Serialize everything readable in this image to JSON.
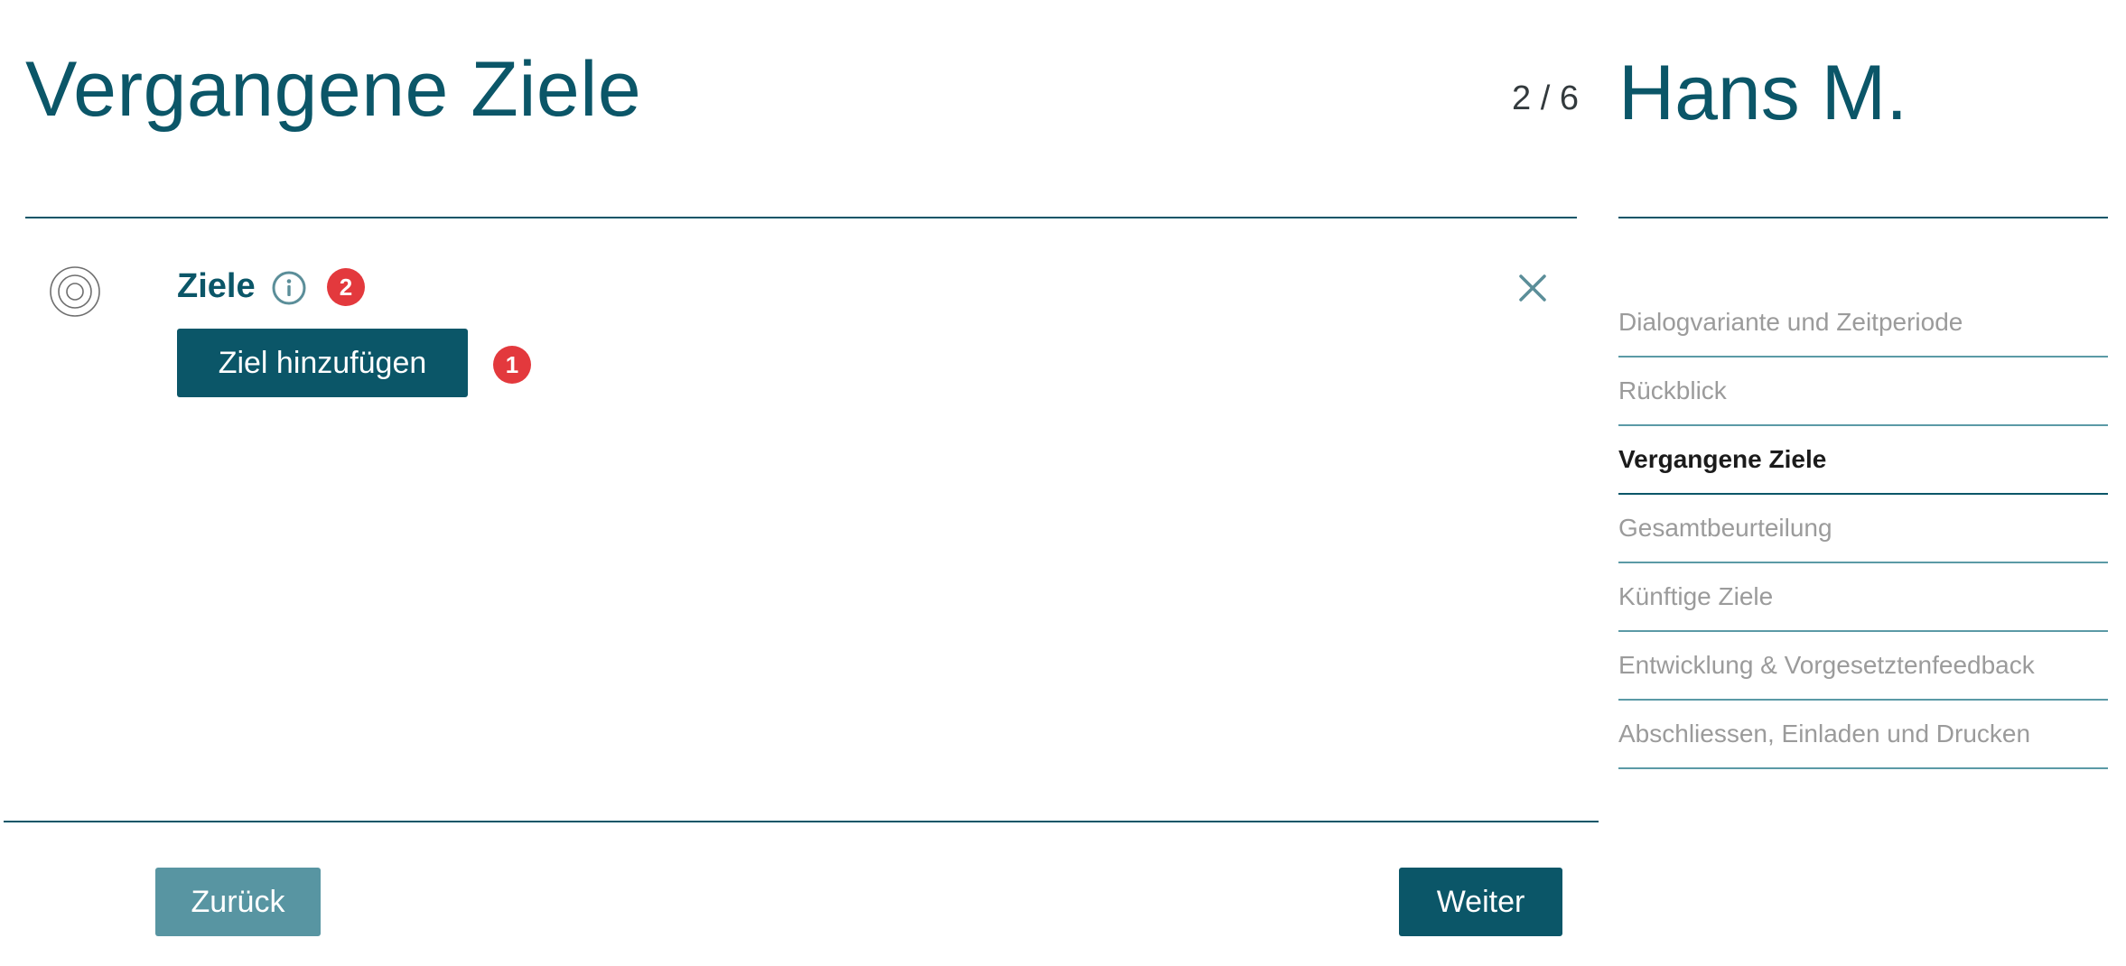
{
  "header": {
    "title": "Vergangene Ziele",
    "step": "2 / 6",
    "person_name": "Hans M."
  },
  "goals": {
    "section_title": "Ziele",
    "info_badge": "2",
    "add_button_label": "Ziel hinzufügen",
    "add_badge": "1",
    "icons": [
      "target-icon",
      "info-icon",
      "close-icon"
    ]
  },
  "navigation": {
    "items": [
      {
        "label": "Dialogvariante und Zeitperiode",
        "active": false
      },
      {
        "label": "Rückblick",
        "active": false
      },
      {
        "label": "Vergangene Ziele",
        "active": true
      },
      {
        "label": "Gesamtbeurteilung",
        "active": false
      },
      {
        "label": "Künftige Ziele",
        "active": false
      },
      {
        "label": "Entwicklung & Vorgesetztenfeedback",
        "active": false
      },
      {
        "label": "Abschliessen, Einladen und Drucken",
        "active": false
      }
    ]
  },
  "footer": {
    "back_label": "Zurück",
    "next_label": "Weiter"
  },
  "colors": {
    "primary": "#0b5668",
    "secondary_button": "#5895a2",
    "badge": "#e3393d",
    "nav_inactive": "#9b9b9b",
    "nav_divider": "#5b9aa6"
  }
}
